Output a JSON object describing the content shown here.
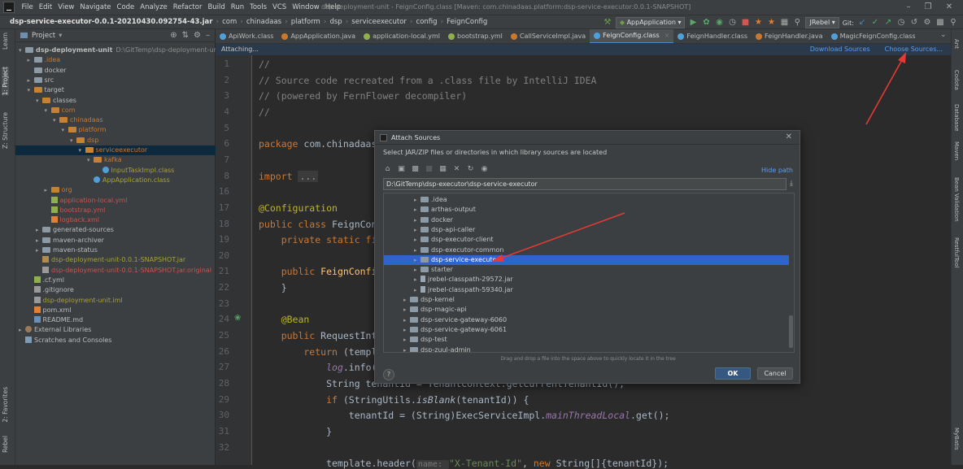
{
  "menu": [
    "File",
    "Edit",
    "View",
    "Navigate",
    "Code",
    "Analyze",
    "Refactor",
    "Build",
    "Run",
    "Tools",
    "VCS",
    "Window",
    "Help"
  ],
  "window_title": "dsp-deployment-unit - FeignConfig.class [Maven: com.chinadaas.platform:dsp-service-executor:0.0.1-SNAPSHOT]",
  "breadcrumbs": [
    "dsp-service-executor-0.0.1-20210430.092754-43.jar",
    "com",
    "chinadaas",
    "platform",
    "dsp",
    "serviceexecutor",
    "config",
    "FeignConfig"
  ],
  "run_config": "AppApplication",
  "jrebel_label": "JRebel",
  "git_label": "Git:",
  "left_tools": [
    "1: Project",
    "Z: Structure",
    "2: Favorites",
    "Learn",
    "Rebel"
  ],
  "right_tools": [
    "Ant",
    "Codota",
    "Database",
    "Maven",
    "Bean Validation",
    "RestfulTool",
    "MyBatis"
  ],
  "project": {
    "header": "Project",
    "tree": [
      {
        "depth": 0,
        "label": "dsp-deployment-unit",
        "extra": "D:\\GitTemp\\dsp-deployment-unit",
        "arrow": "down",
        "icon": "folder",
        "color": "white",
        "bold": true
      },
      {
        "depth": 1,
        "label": ".idea",
        "arrow": "right",
        "icon": "folder",
        "color": "orange"
      },
      {
        "depth": 1,
        "label": "docker",
        "arrow": "",
        "icon": "folder",
        "color": "white"
      },
      {
        "depth": 1,
        "label": "src",
        "arrow": "right",
        "icon": "folder",
        "color": "white"
      },
      {
        "depth": 1,
        "label": "target",
        "arrow": "down",
        "icon": "folder-orange",
        "color": "white"
      },
      {
        "depth": 2,
        "label": "classes",
        "arrow": "down",
        "icon": "folder-orange",
        "color": "white"
      },
      {
        "depth": 3,
        "label": "com",
        "arrow": "down",
        "icon": "folder-orange",
        "color": "orange"
      },
      {
        "depth": 4,
        "label": "chinadaas",
        "arrow": "down",
        "icon": "folder-orange",
        "color": "orange"
      },
      {
        "depth": 5,
        "label": "platform",
        "arrow": "down",
        "icon": "folder-orange",
        "color": "orange"
      },
      {
        "depth": 6,
        "label": "dsp",
        "arrow": "down",
        "icon": "folder-orange",
        "color": "orange"
      },
      {
        "depth": 7,
        "label": "serviceexecutor",
        "arrow": "down",
        "icon": "folder-orange",
        "color": "orange",
        "selected": true
      },
      {
        "depth": 8,
        "label": "kafka",
        "arrow": "down",
        "icon": "folder-orange",
        "color": "orange"
      },
      {
        "depth": 9,
        "label": "InputTaskImpl.class",
        "arrow": "",
        "icon": "class",
        "color": "yellow"
      },
      {
        "depth": 8,
        "label": "AppApplication.class",
        "arrow": "",
        "icon": "class",
        "color": "yellow"
      },
      {
        "depth": 3,
        "label": "org",
        "arrow": "right",
        "icon": "folder-orange",
        "color": "orange"
      },
      {
        "depth": 3,
        "label": "application-local.yml",
        "arrow": "",
        "icon": "yml",
        "color": "red"
      },
      {
        "depth": 3,
        "label": "bootstrap.yml",
        "arrow": "",
        "icon": "yml",
        "color": "red"
      },
      {
        "depth": 3,
        "label": "logback.xml",
        "arrow": "",
        "icon": "xml",
        "color": "red"
      },
      {
        "depth": 2,
        "label": "generated-sources",
        "arrow": "right",
        "icon": "folder",
        "color": "white"
      },
      {
        "depth": 2,
        "label": "maven-archiver",
        "arrow": "right",
        "icon": "folder",
        "color": "white"
      },
      {
        "depth": 2,
        "label": "maven-status",
        "arrow": "right",
        "icon": "folder",
        "color": "white"
      },
      {
        "depth": 2,
        "label": "dsp-deployment-unit-0.0.1-SNAPSHOT.jar",
        "arrow": "",
        "icon": "jar",
        "color": "yellow"
      },
      {
        "depth": 2,
        "label": "dsp-deployment-unit-0.0.1-SNAPSHOT.jar.original",
        "arrow": "",
        "icon": "file",
        "color": "red"
      },
      {
        "depth": 1,
        "label": ".cf.yml",
        "arrow": "",
        "icon": "yml",
        "color": "white"
      },
      {
        "depth": 1,
        "label": ".gitignore",
        "arrow": "",
        "icon": "file",
        "color": "white"
      },
      {
        "depth": 1,
        "label": "dsp-deployment-unit.iml",
        "arrow": "",
        "icon": "file",
        "color": "yellow"
      },
      {
        "depth": 1,
        "label": "pom.xml",
        "arrow": "",
        "icon": "xml",
        "color": "white"
      },
      {
        "depth": 1,
        "label": "README.md",
        "arrow": "",
        "icon": "md",
        "color": "white"
      },
      {
        "depth": 0,
        "label": "External Libraries",
        "arrow": "right",
        "icon": "lib",
        "color": "white"
      },
      {
        "depth": 0,
        "label": "Scratches and Consoles",
        "arrow": "",
        "icon": "scratch",
        "color": "white"
      }
    ]
  },
  "tabs": [
    {
      "label": "ApiWork.class",
      "active": false,
      "color": "#4fa0d8"
    },
    {
      "label": "AppApplication.java",
      "active": false,
      "color": "#c9782e"
    },
    {
      "label": "application-local.yml",
      "active": false,
      "color": "#8fae4c"
    },
    {
      "label": "bootstrap.yml",
      "active": false,
      "color": "#8fae4c"
    },
    {
      "label": "CallServiceImpl.java",
      "active": false,
      "color": "#c9782e"
    },
    {
      "label": "FeignConfig.class",
      "active": true,
      "color": "#4fa0d8"
    },
    {
      "label": "FeignHandler.class",
      "active": false,
      "color": "#4fa0d8"
    },
    {
      "label": "FeignHandler.java",
      "active": false,
      "color": "#c9782e"
    },
    {
      "label": "MagicFeignConfig.class",
      "active": false,
      "color": "#4fa0d8"
    }
  ],
  "infobar": {
    "text": "Attaching...",
    "download": "Download Sources",
    "choose": "Choose Sources..."
  },
  "line_numbers": [
    "1",
    "2",
    "3",
    "4",
    "5",
    "6",
    "7",
    "8",
    "16",
    "17",
    "18",
    "19",
    "20",
    "21",
    "22",
    "23",
    "24",
    "25",
    "26",
    "27",
    "28",
    "29",
    "30",
    "31",
    "32"
  ],
  "code_lines": [
    [
      {
        "t": "//",
        "c": "cm"
      }
    ],
    [
      {
        "t": "// Source code recreated from a .class file by IntelliJ IDEA",
        "c": "cm"
      }
    ],
    [
      {
        "t": "// (powered by FernFlower decompiler)",
        "c": "cm"
      }
    ],
    [
      {
        "t": "//",
        "c": "cm"
      }
    ],
    [],
    [
      {
        "t": "package ",
        "c": "kw"
      },
      {
        "t": "com.chinadaas.platform.dsp.serviceexecutor.config;",
        "c": ""
      }
    ],
    [],
    [
      {
        "t": "import ",
        "c": "kw"
      },
      {
        "t": "...",
        "c": "fold-box"
      }
    ],
    [],
    [
      {
        "t": "@Configuration",
        "c": "an"
      }
    ],
    [
      {
        "t": "public class ",
        "c": "kw"
      },
      {
        "t": "FeignConfig {",
        "c": ""
      }
    ],
    [
      {
        "t": "    private static final ",
        "c": "kw"
      },
      {
        "t": "Logger ",
        "c": ""
      },
      {
        "t": "log",
        "c": "fld itl"
      },
      {
        "t": " = LoggerFactory.getLogger(FeignConfig.class);",
        "c": ""
      }
    ],
    [],
    [
      {
        "t": "    public ",
        "c": "kw"
      },
      {
        "t": "FeignConfig",
        "c": "fn"
      },
      {
        "t": "() {",
        "c": ""
      }
    ],
    [
      {
        "t": "    }",
        "c": ""
      }
    ],
    [],
    [
      {
        "t": "    @Bean",
        "c": "an"
      }
    ],
    [
      {
        "t": "    public ",
        "c": "kw"
      },
      {
        "t": "RequestInterceptor ",
        "c": ""
      },
      {
        "t": "requestInterceptor",
        "c": "fn"
      },
      {
        "t": "() {",
        "c": ""
      }
    ],
    [
      {
        "t": "        return ",
        "c": "kw"
      },
      {
        "t": "(template) -> {",
        "c": ""
      }
    ],
    [
      {
        "t": "            ",
        "c": ""
      },
      {
        "t": "log",
        "c": "fld itl"
      },
      {
        "t": ".info(",
        "c": ""
      },
      {
        "t": "\"feign request ...\"",
        "c": "st"
      },
      {
        "t": ");",
        "c": ""
      }
    ],
    [
      {
        "t": "            String tenantId = TenantContext.getCurrentTenantId();",
        "c": ""
      }
    ],
    [
      {
        "t": "            ",
        "c": ""
      },
      {
        "t": "if ",
        "c": "kw"
      },
      {
        "t": "(StringUtils.",
        "c": ""
      },
      {
        "t": "isBlank",
        "c": "itl"
      },
      {
        "t": "(tenantId)) {",
        "c": ""
      }
    ],
    [
      {
        "t": "                tenantId = (String)ExecServiceImpl.",
        "c": ""
      },
      {
        "t": "mainThreadLocal",
        "c": "fld itl"
      },
      {
        "t": ".get();",
        "c": ""
      }
    ],
    [
      {
        "t": "            }",
        "c": ""
      }
    ],
    [],
    [
      {
        "t": "            template.header(",
        "c": ""
      },
      {
        "t": "name: ",
        "c": "hint"
      },
      {
        "t": "\"X-Tenant-Id\"",
        "c": "st"
      },
      {
        "t": ", ",
        "c": ""
      },
      {
        "t": "new ",
        "c": "kw"
      },
      {
        "t": "String[]{tenantId});",
        "c": ""
      }
    ]
  ],
  "dialog": {
    "title": "Attach Sources",
    "description": "Select JAR/ZIP files or directories in which library sources are located",
    "hide_path": "Hide path",
    "path": "D:\\GitTemp\\dsp-executor\\dsp-service-executor",
    "tree": [
      {
        "depth": 3,
        "label": ".idea",
        "arrow": "right",
        "icon": "folder"
      },
      {
        "depth": 3,
        "label": "arthas-output",
        "arrow": "right",
        "icon": "folder"
      },
      {
        "depth": 3,
        "label": "docker",
        "arrow": "right",
        "icon": "folder"
      },
      {
        "depth": 3,
        "label": "dsp-api-caller",
        "arrow": "right",
        "icon": "folder"
      },
      {
        "depth": 3,
        "label": "dsp-executor-client",
        "arrow": "right",
        "icon": "folder"
      },
      {
        "depth": 3,
        "label": "dsp-executor-common",
        "arrow": "right",
        "icon": "folder"
      },
      {
        "depth": 3,
        "label": "dsp-service-executor",
        "arrow": "right",
        "icon": "folder",
        "selected": true
      },
      {
        "depth": 3,
        "label": "starter",
        "arrow": "right",
        "icon": "folder"
      },
      {
        "depth": 3,
        "label": "jrebel-classpath-29572.jar",
        "arrow": "right",
        "icon": "jar"
      },
      {
        "depth": 3,
        "label": "jrebel-classpath-59340.jar",
        "arrow": "right",
        "icon": "jar"
      },
      {
        "depth": 2,
        "label": "dsp-kernel",
        "arrow": "right",
        "icon": "folder"
      },
      {
        "depth": 2,
        "label": "dsp-magic-api",
        "arrow": "right",
        "icon": "folder"
      },
      {
        "depth": 2,
        "label": "dsp-service-gateway-6060",
        "arrow": "right",
        "icon": "folder"
      },
      {
        "depth": 2,
        "label": "dsp-service-gateway-6061",
        "arrow": "right",
        "icon": "folder"
      },
      {
        "depth": 2,
        "label": "dsp-test",
        "arrow": "right",
        "icon": "folder"
      },
      {
        "depth": 2,
        "label": "dsp-zuul-admin",
        "arrow": "right",
        "icon": "folder"
      }
    ],
    "drag_hint": "Drag and drop a file into the space above to quickly locate it in the tree",
    "help": "?",
    "ok": "OK",
    "cancel": "Cancel"
  },
  "colors": {
    "accent": "#4a88c7",
    "selection": "#2f65ca",
    "arrow": "#e53935",
    "link": "#589df6"
  }
}
